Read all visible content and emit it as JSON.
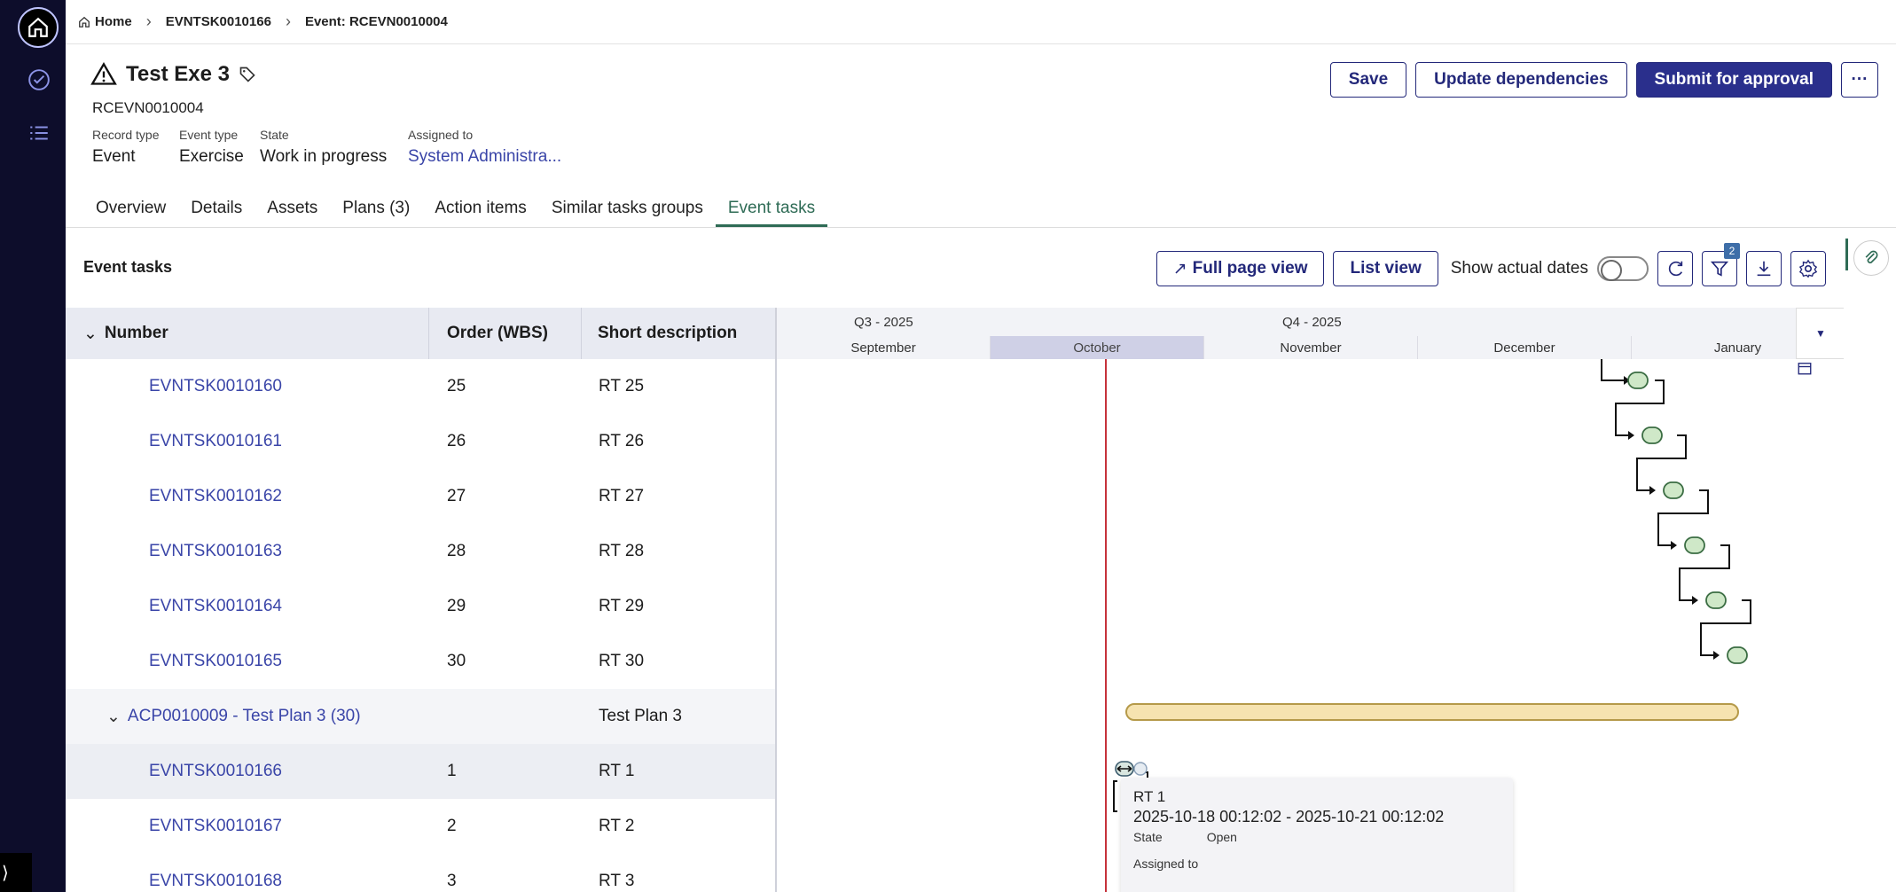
{
  "breadcrumbs": [
    {
      "label": "Home"
    },
    {
      "label": "EVNTSK0010166"
    },
    {
      "label": "Event: RCEVN0010004"
    }
  ],
  "record": {
    "title": "Test Exe 3",
    "number": "RCEVN0010004",
    "fields": [
      {
        "label": "Record type",
        "value": "Event"
      },
      {
        "label": "Event type",
        "value": "Exercise"
      },
      {
        "label": "State",
        "value": "Work in progress"
      },
      {
        "label": "Assigned to",
        "value": "System Administra..."
      }
    ]
  },
  "actions": {
    "save": "Save",
    "update_dependencies": "Update dependencies",
    "submit": "Submit for approval",
    "more": "···"
  },
  "tabs": [
    {
      "label": "Overview"
    },
    {
      "label": "Details"
    },
    {
      "label": "Assets"
    },
    {
      "label": "Plans (3)"
    },
    {
      "label": "Action items"
    },
    {
      "label": "Similar tasks groups"
    },
    {
      "label": "Event tasks",
      "active": true
    }
  ],
  "panel": {
    "title": "Event tasks",
    "full_page": "Full page view",
    "list_view": "List view",
    "show_actual": "Show actual dates",
    "filter_count": "2"
  },
  "grid": {
    "headers": {
      "number": "Number",
      "order": "Order (WBS)",
      "desc": "Short description"
    },
    "rows": [
      {
        "number": "EVNTSK0010160",
        "order": "25",
        "desc": "RT 25"
      },
      {
        "number": "EVNTSK0010161",
        "order": "26",
        "desc": "RT 26"
      },
      {
        "number": "EVNTSK0010162",
        "order": "27",
        "desc": "RT 27"
      },
      {
        "number": "EVNTSK0010163",
        "order": "28",
        "desc": "RT 28"
      },
      {
        "number": "EVNTSK0010164",
        "order": "29",
        "desc": "RT 29"
      },
      {
        "number": "EVNTSK0010165",
        "order": "30",
        "desc": "RT 30"
      },
      {
        "number": "ACP0010009 - Test Plan 3 (30)",
        "order": "",
        "desc": "Test Plan 3",
        "group": true
      },
      {
        "number": "EVNTSK0010166",
        "order": "1",
        "desc": "RT 1"
      },
      {
        "number": "EVNTSK0010167",
        "order": "2",
        "desc": "RT 2"
      },
      {
        "number": "EVNTSK0010168",
        "order": "3",
        "desc": "RT 3"
      }
    ]
  },
  "timeline": {
    "quarters": [
      "Q3 - 2025",
      "Q4 - 2025"
    ],
    "months": [
      "September",
      "October",
      "November",
      "December",
      "January"
    ],
    "highlighted_month": "October"
  },
  "tooltip": {
    "title": "RT 1",
    "dates": "2025-10-18 00:12:02 - 2025-10-21 00:12:02",
    "state_label": "State",
    "state_value": "Open",
    "assigned_label": "Assigned to"
  },
  "colors": {
    "primary": "#2a2f8c",
    "link": "#3a45a8",
    "active_tab": "#2e6b55",
    "today_line": "#c6323b",
    "milestone_fill": "#cfe8c8",
    "plan_bar": "#f6e3b0"
  }
}
